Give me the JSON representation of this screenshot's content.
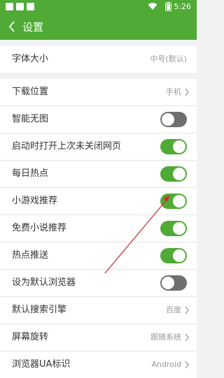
{
  "status_bar": {
    "time": "5:26"
  },
  "header": {
    "title": "设置"
  },
  "section_1": {
    "font_size": {
      "label": "字体大小",
      "value": "中号(默认)"
    }
  },
  "section_2": {
    "download_location": {
      "label": "下载位置",
      "value": "手机"
    },
    "no_image_mode": {
      "label": "智能无图",
      "enabled": false
    },
    "restore_pages": {
      "label": "启动时打开上次未关闭网页",
      "enabled": true
    },
    "daily_hot": {
      "label": "每日热点",
      "enabled": true
    },
    "mini_game_recommend": {
      "label": "小游戏推荐",
      "enabled": true
    },
    "free_novel_recommend": {
      "label": "免费小说推荐",
      "enabled": true
    },
    "hot_push": {
      "label": "热点推送",
      "enabled": true
    },
    "default_browser": {
      "label": "设为默认浏览器",
      "enabled": false
    },
    "search_engine": {
      "label": "默认搜索引擎",
      "value": "百度"
    },
    "screen_rotation": {
      "label": "屏幕旋转",
      "value": "跟随系统"
    },
    "ua_identity": {
      "label": "浏览器UA标识",
      "value": "Android"
    }
  },
  "colors": {
    "brand_green": "#4fab35",
    "toggle_off": "#6f6f6f",
    "annotation_red": "#d32f2f"
  }
}
